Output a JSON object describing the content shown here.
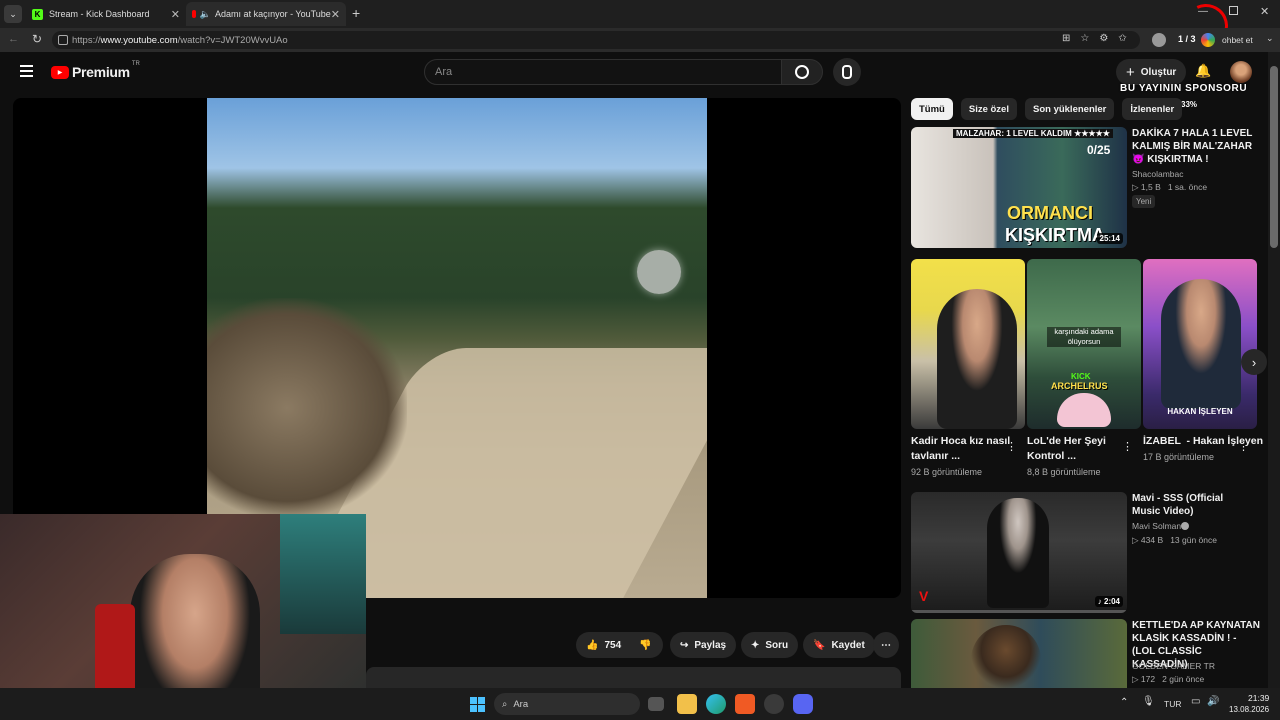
{
  "browser": {
    "tabs": [
      {
        "title": "Stream - Kick Dashboard"
      },
      {
        "title": "Adamı at kaçınyor - YouTube"
      }
    ],
    "url_prefix": "https://",
    "url_host": "www.youtube.com",
    "url_path": "/watch?v=JWT20WvvUAo",
    "profile_count": "1 / 3",
    "sidebar_label": "ohbet et"
  },
  "youtube": {
    "logo_text": "Premium",
    "logo_sup": "TR",
    "search_placeholder": "Ara",
    "create_label": "Oluştur"
  },
  "overlay": {
    "sponsor_text": "BU YAYININ SPONSORU",
    "progress": "33%"
  },
  "chips": [
    "Tümü",
    "Size özel",
    "Son yüklenenler",
    "İzlenenler"
  ],
  "actions": {
    "like_count": "754",
    "share_label": "Paylaş",
    "ask_label": "Soru",
    "save_label": "Kaydet"
  },
  "recommendations": [
    {
      "title": "DAKİKA 7 HALA 1 LEVEL KALMIŞ BİR MAL'ZAHAR 😈 KIŞKIRTMA !",
      "channel": "Shacolambac",
      "meta": "▷ 1,5 B   1 sa. önce",
      "badge": "Yeni",
      "duration": "25:14",
      "thumb_top": "MALZAHAR: 1 LEVEL KALDIM ★★★★★",
      "thumb_score": "0/25",
      "thumb_big1": "ORMANCI",
      "thumb_big2": "KIŞKIRTMA"
    },
    {
      "title": "Mavi - SSS (Official Music Video)",
      "channel": "Mavi Solman",
      "meta": "▷ 434 B   13 gün önce",
      "duration": "♪ 2:04"
    },
    {
      "title": "KETTLE'DA AP KAYNATAN KLASİK KASSADİN ! - (LOL CLASSİC KASSADİN)",
      "channel": "GOLDEN GAMER TR",
      "meta": "▷ 172   2 gün önce"
    }
  ],
  "shorts": [
    {
      "title": "Kadir Hoca kız nasıl tavlanır ...",
      "views": "92 B görüntüleme"
    },
    {
      "title": "LoL'de Her Şeyi Kontrol ...",
      "views": "8,8 B görüntüleme",
      "caption": "karşındaki adama ölüyorsun",
      "kick": "KICK",
      "name": "ARCHELRUS"
    },
    {
      "title": "İZABEL  - Hakan İşleyen",
      "views": "17 B görüntüleme",
      "overlay": "HAKAN İŞLEYEN"
    }
  ],
  "taskbar": {
    "search": "Ara",
    "lang": "TUR",
    "time": "21:39",
    "date": "13.08.2026"
  }
}
